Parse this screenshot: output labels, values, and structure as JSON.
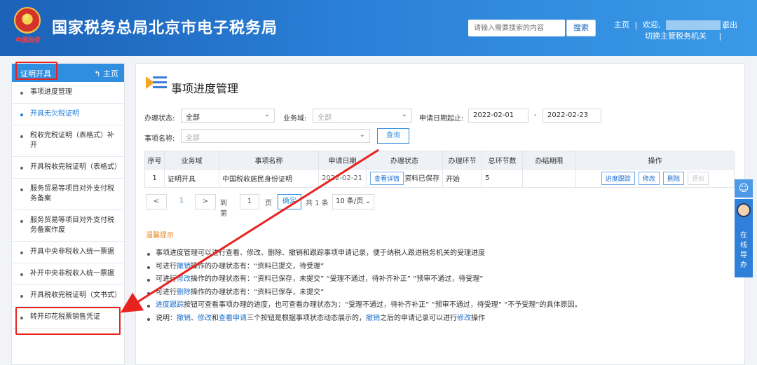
{
  "header": {
    "site_title": "国家税务总局北京市电子税务局",
    "emblem_tag": "中国税务",
    "search_placeholder": "请输入需要搜索的内容",
    "search_button": "搜索",
    "home_link": "主页",
    "separator": "|",
    "welcome": "欢迎,",
    "switch_authority": "切换主管税务机关",
    "logout": "退出"
  },
  "sidebar": {
    "header_label": "证明开具",
    "home_label": "主页",
    "items": [
      {
        "label": "事项进度管理"
      },
      {
        "label": "开具无欠税证明"
      },
      {
        "label": "税收完税证明（表格式）补开"
      },
      {
        "label": "开具税收完税证明（表格式）"
      },
      {
        "label": "服务贸易等项目对外支付税务备案"
      },
      {
        "label": "服务贸易等项目对外支付税务备案作废"
      },
      {
        "label": "开具中央非税收入统一票据"
      },
      {
        "label": "补开中央非税收入统一票据"
      },
      {
        "label": "开具税收完税证明（文书式）"
      },
      {
        "label": "转开印花税票销售凭证"
      }
    ]
  },
  "main": {
    "title": "事项进度管理",
    "filters": {
      "status_label": "办理状态:",
      "status_value": "全部",
      "domain_label": "业务域:",
      "domain_value": "全部",
      "date_label": "申请日期起止:",
      "date_from": "2022-02-01",
      "date_sep": "-",
      "date_to": "2022-02-23",
      "name_label": "事项名称:",
      "name_value": "全部",
      "query_button": "查询"
    },
    "table": {
      "headers": [
        "序号",
        "业务域",
        "事项名称",
        "申请日期",
        "办理状态",
        "办理环节",
        "总环节数",
        "办结期限",
        "操作"
      ],
      "rows": [
        {
          "index": "1",
          "domain": "证明开具",
          "name": "中国税收居民身份证明",
          "date": "2022-02-21",
          "detail_button": "查看详情",
          "status": "资料已保存",
          "stage": "开始",
          "total": "5",
          "deadline": "",
          "actions": [
            "进度跟踪",
            "修改",
            "删除",
            "评价"
          ]
        }
      ]
    },
    "pager": {
      "prev": "<",
      "page": "1",
      "next": ">",
      "goto_label": "到第",
      "goto_value": "1",
      "page_unit": "页",
      "confirm": "确定",
      "total": "共 1 条",
      "page_size": "10 条/页"
    },
    "tips": {
      "title": "温馨提示",
      "t1": "事项进度管理可以进行查看、修改、删除、撤销和跟踪事项申请记录，便于纳税人跟进税务机关的受理进度",
      "t2_pre": "可进行",
      "t2_link": "撤销",
      "t2_post": "操作的办理状态有：“资料已提交，待受理”",
      "t3_pre": "可进行",
      "t3_link": "修改",
      "t3_post": "操作的办理状态有：“资料已保存，未提交” “受理不通过，待补齐补正” “预审不通过，待受理”",
      "t4_pre": "可进行",
      "t4_link": "删除",
      "t4_post": "操作的办理状态有：“资料已保存，未提交”",
      "t5_link": "进度跟踪",
      "t5_post": "按钮可查看事项办理的进度，也可查看办理状态为：“受理不通过，待补齐补正” “预审不通过，待受理” “不予受理”的具体原因。",
      "t6_pre": "说明：",
      "t6_l1": "撤销",
      "t6_s1": "、",
      "t6_l2": "修改",
      "t6_s2": "和",
      "t6_l3": "查看申请",
      "t6_mid": "三个按钮是根据事项状态动态展示的，",
      "t6_l4": "撤销",
      "t6_mid2": "之后的申请记录可以进行",
      "t6_l5": "修改",
      "t6_end": "操作"
    }
  },
  "widget": {
    "online_guide": "在线导办"
  },
  "colors": {
    "header_blue": "#2a7fd6",
    "accent_blue": "#2f8ee0",
    "annotation_red": "#e8231f",
    "tips_orange": "#e6821a"
  }
}
